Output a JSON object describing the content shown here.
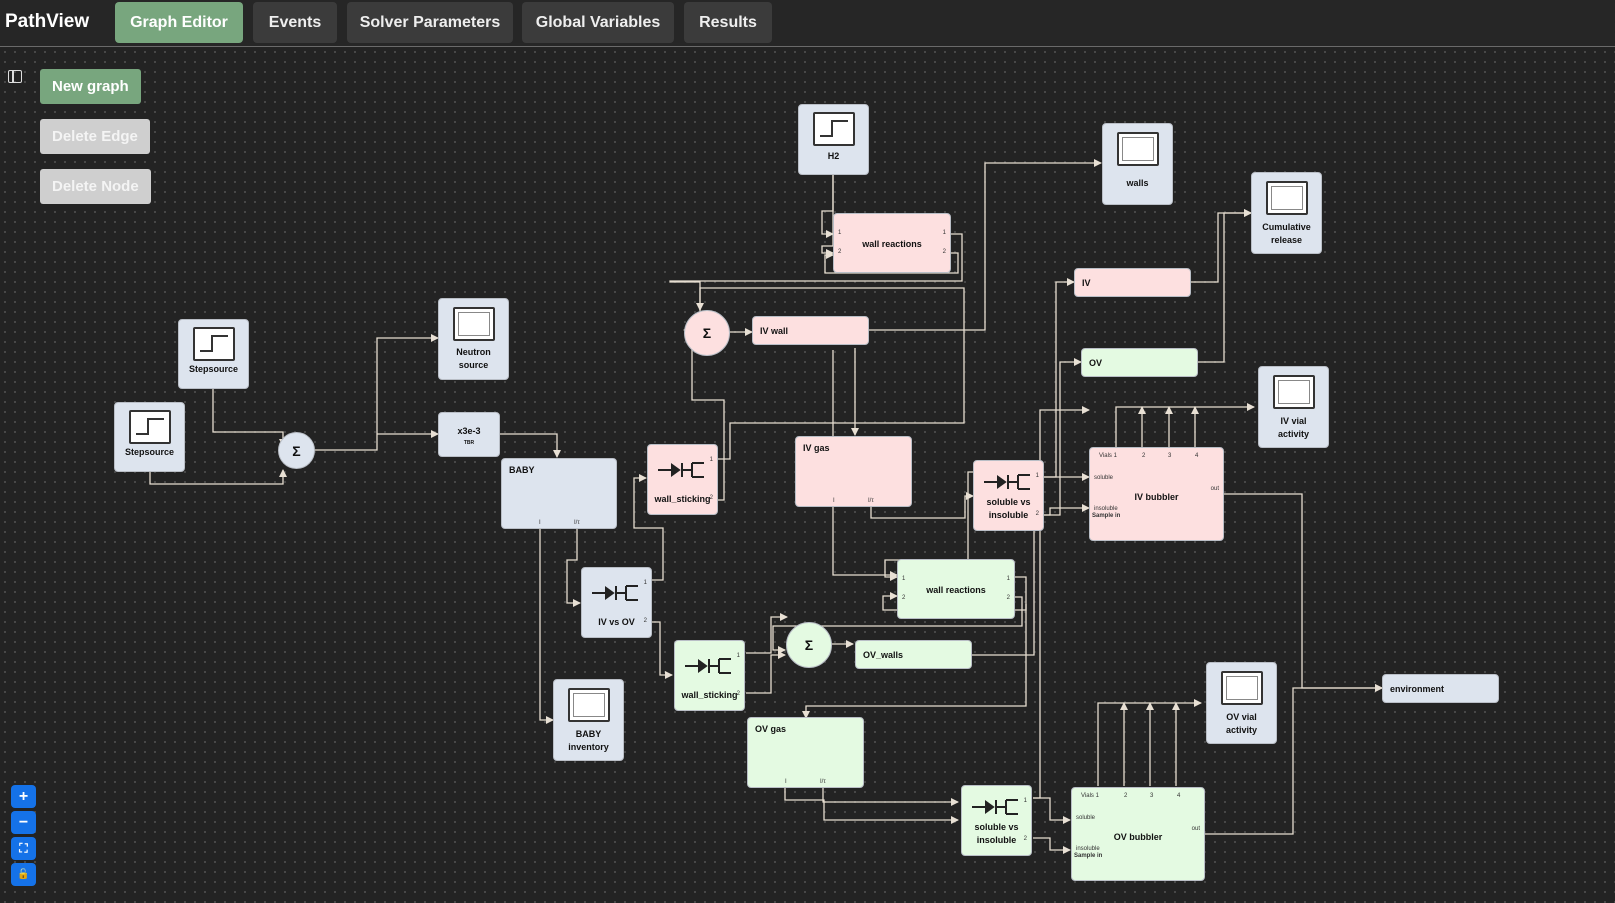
{
  "app": {
    "title": "PathView"
  },
  "tabs": [
    {
      "label": "Graph Editor",
      "active": true
    },
    {
      "label": "Events",
      "active": false
    },
    {
      "label": "Solver Parameters",
      "active": false
    },
    {
      "label": "Global Variables",
      "active": false
    },
    {
      "label": "Results",
      "active": false
    }
  ],
  "toolbar": {
    "new_graph": "New graph",
    "delete_edge": "Delete Edge",
    "delete_node": "Delete Node"
  },
  "zoom_controls": [
    {
      "icon": "plus-icon",
      "glyph": "+"
    },
    {
      "icon": "minus-icon",
      "glyph": "−"
    },
    {
      "icon": "fit-view-icon",
      "glyph": "⛶"
    },
    {
      "icon": "lock-icon",
      "glyph": "🔓"
    }
  ],
  "colors": {
    "accent": "#78a67e",
    "zoom": "#1572e8",
    "node_gray": "#dde4ee",
    "node_pink": "#fde0e0",
    "node_green": "#e4fae2"
  },
  "nodes": {
    "h2": "H2",
    "walls": "walls",
    "cumulative_release_1": "Cumulative",
    "cumulative_release_2": "release",
    "wall_reactions_iv": "wall reactions",
    "iv": "IV",
    "iv_wall": "IV wall",
    "ov": "OV",
    "neutron_source_1": "Neutron",
    "neutron_source_2": "source",
    "stepsource_1": "Stepsource",
    "stepsource_2": "Stepsource",
    "gain": "x3e-3",
    "gain_sub": "TBR",
    "iv_vial_activity_1": "IV vial",
    "iv_vial_activity_2": "activity",
    "baby": "BABY",
    "wall_sticking_iv": "wall_sticking",
    "iv_gas": "IV gas",
    "soluble_vs_insoluble_iv_1": "soluble vs",
    "soluble_vs_insoluble_iv_2": "insoluble",
    "iv_bubbler": "IV bubbler",
    "iv_vs_ov": "IV vs OV",
    "wall_reactions_ov": "wall reactions",
    "wall_sticking_ov": "wall_sticking",
    "ov_walls": "OV_walls",
    "environment": "environment",
    "baby_inventory_1": "BABY",
    "baby_inventory_2": "inventory",
    "ov_vial_activity_1": "OV vial",
    "ov_vial_activity_2": "activity",
    "ov_gas": "OV gas",
    "soluble_vs_insoluble_ov_1": "soluble vs",
    "soluble_vs_insoluble_ov_2": "insoluble",
    "ov_bubbler": "OV bubbler"
  },
  "ports": {
    "vials": "Vials 1",
    "v2": "2",
    "v3": "3",
    "v4": "4",
    "soluble": "soluble",
    "insoluble": "insoluble",
    "sample_in": "Sample in",
    "out": "out",
    "one": "1",
    "two": "2",
    "i": "I",
    "iover": "I/τ"
  }
}
